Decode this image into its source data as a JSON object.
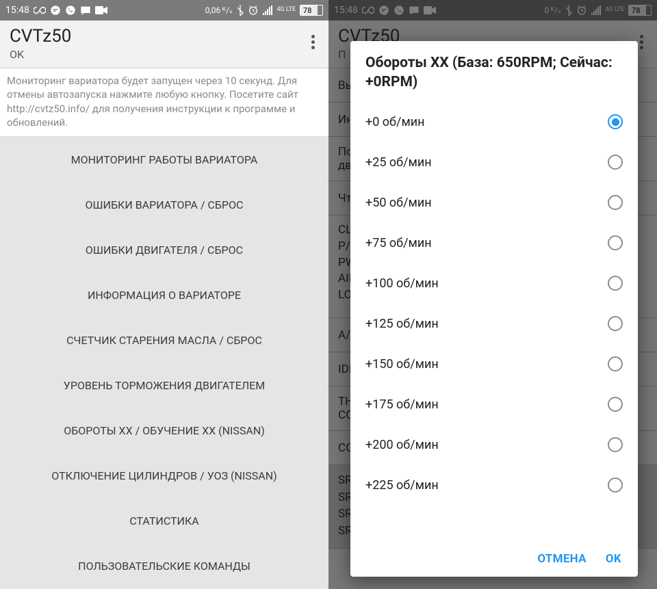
{
  "status": {
    "time": "15:48",
    "net_left": "0,06 ᴷ/ₛ",
    "net_right": "0 ᴷ/ₛ",
    "net_badge": "4G LTE",
    "battery": "78"
  },
  "left": {
    "app_title": "CVTz50",
    "app_subtitle": "OK",
    "info": "Мониторинг вариатора будет запущен через 10 секунд. Для отмены автозапуска нажмите любую кнопку. Посетите сайт http://cvtz50.info/ для получения инструкции к программе и обновлений.",
    "menu": [
      "МОНИТОРИНГ РАБОТЫ ВАРИАТОРА",
      "ОШИБКИ ВАРИАТОРА / СБРОС",
      "ОШИБКИ ДВИГАТЕЛЯ / СБРОС",
      "ИНФОРМАЦИЯ О ВАРИАТОРЕ",
      "СЧЕТЧИК СТАРЕНИЯ МАСЛА / СБРОС",
      "УРОВЕНЬ ТОРМОЖЕНИЯ ДВИГАТЕЛЕМ",
      "ОБОРОТЫ ХХ / ОБУЧЕНИЕ ХХ (NISSAN)",
      "ОТКЛЮЧЕНИЕ ЦИЛИНДРОВ / УОЗ (NISSAN)",
      "СТАТИСТИКА",
      "ПОЛЬЗОВАТЕЛЬСКИЕ КОМАНДЫ"
    ]
  },
  "right": {
    "bg_rows": [
      "Вь",
      "Ин",
      "По дв",
      "Чт",
      "CL P/I PW AIR LO",
      "A/V",
      "IDL",
      "TH CO",
      "CO",
      "SR SR SR SR"
    ],
    "dialog_title": "Обороты ХХ (База: 650RPM; Сейчас: +0RPM)",
    "options": [
      "+0 об/мин",
      "+25 об/мин",
      "+50 об/мин",
      "+75 об/мин",
      "+100 об/мин",
      "+125 об/мин",
      "+150 об/мин",
      "+175 об/мин",
      "+200 об/мин",
      "+225 об/мин"
    ],
    "selected_index": 0,
    "btn_cancel": "ОТМЕНА",
    "btn_ok": "OK"
  }
}
